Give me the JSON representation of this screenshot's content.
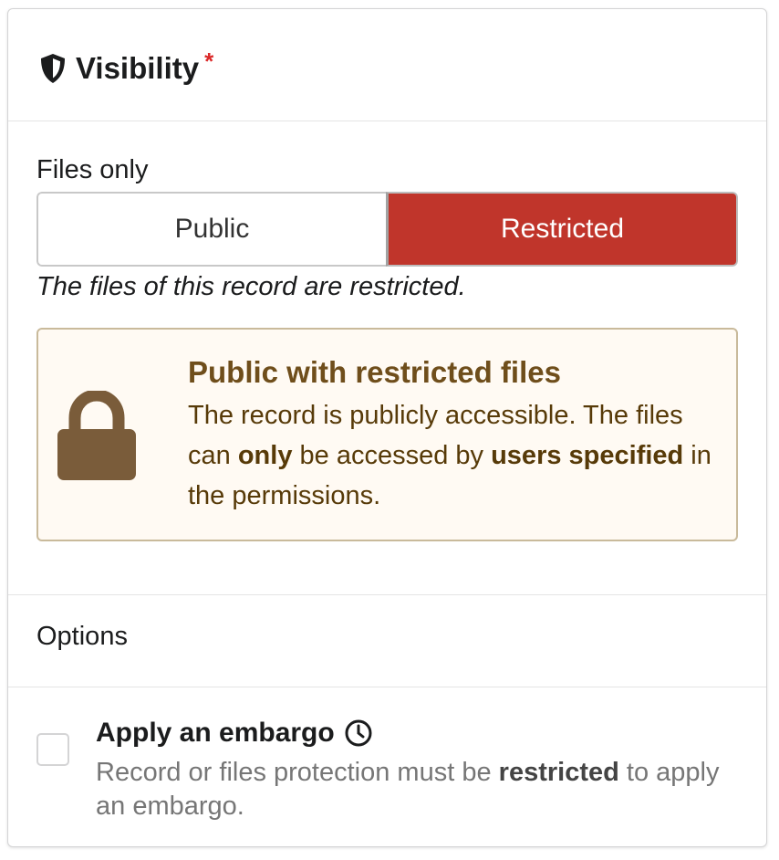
{
  "header": {
    "title": "Visibility",
    "required_mark": "*",
    "icon": "shield-icon"
  },
  "files": {
    "label": "Files only",
    "options": [
      "Public",
      "Restricted"
    ],
    "selected": "Restricted",
    "note": "The files of this record are restricted."
  },
  "message": {
    "icon": "lock-icon",
    "title": "Public with restricted files",
    "text_part1": "The record is publicly accessible. The files can ",
    "text_bold1": "only",
    "text_part2": " be accessed by ",
    "text_bold2": "users specified",
    "text_part3": " in the permissions."
  },
  "options": {
    "label": "Options"
  },
  "embargo": {
    "title": "Apply an embargo",
    "icon": "clock-icon",
    "checked": false,
    "desc_part1": "Record or files protection must be ",
    "desc_bold": "restricted",
    "desc_part2": " to apply an embargo."
  },
  "colors": {
    "restricted_bg": "#c0352b",
    "warning_bg": "#fffaf3",
    "warning_border": "#c9ba9b",
    "warning_title": "#6f4e1b",
    "lock": "#7a5c3a",
    "required": "#db2828"
  }
}
